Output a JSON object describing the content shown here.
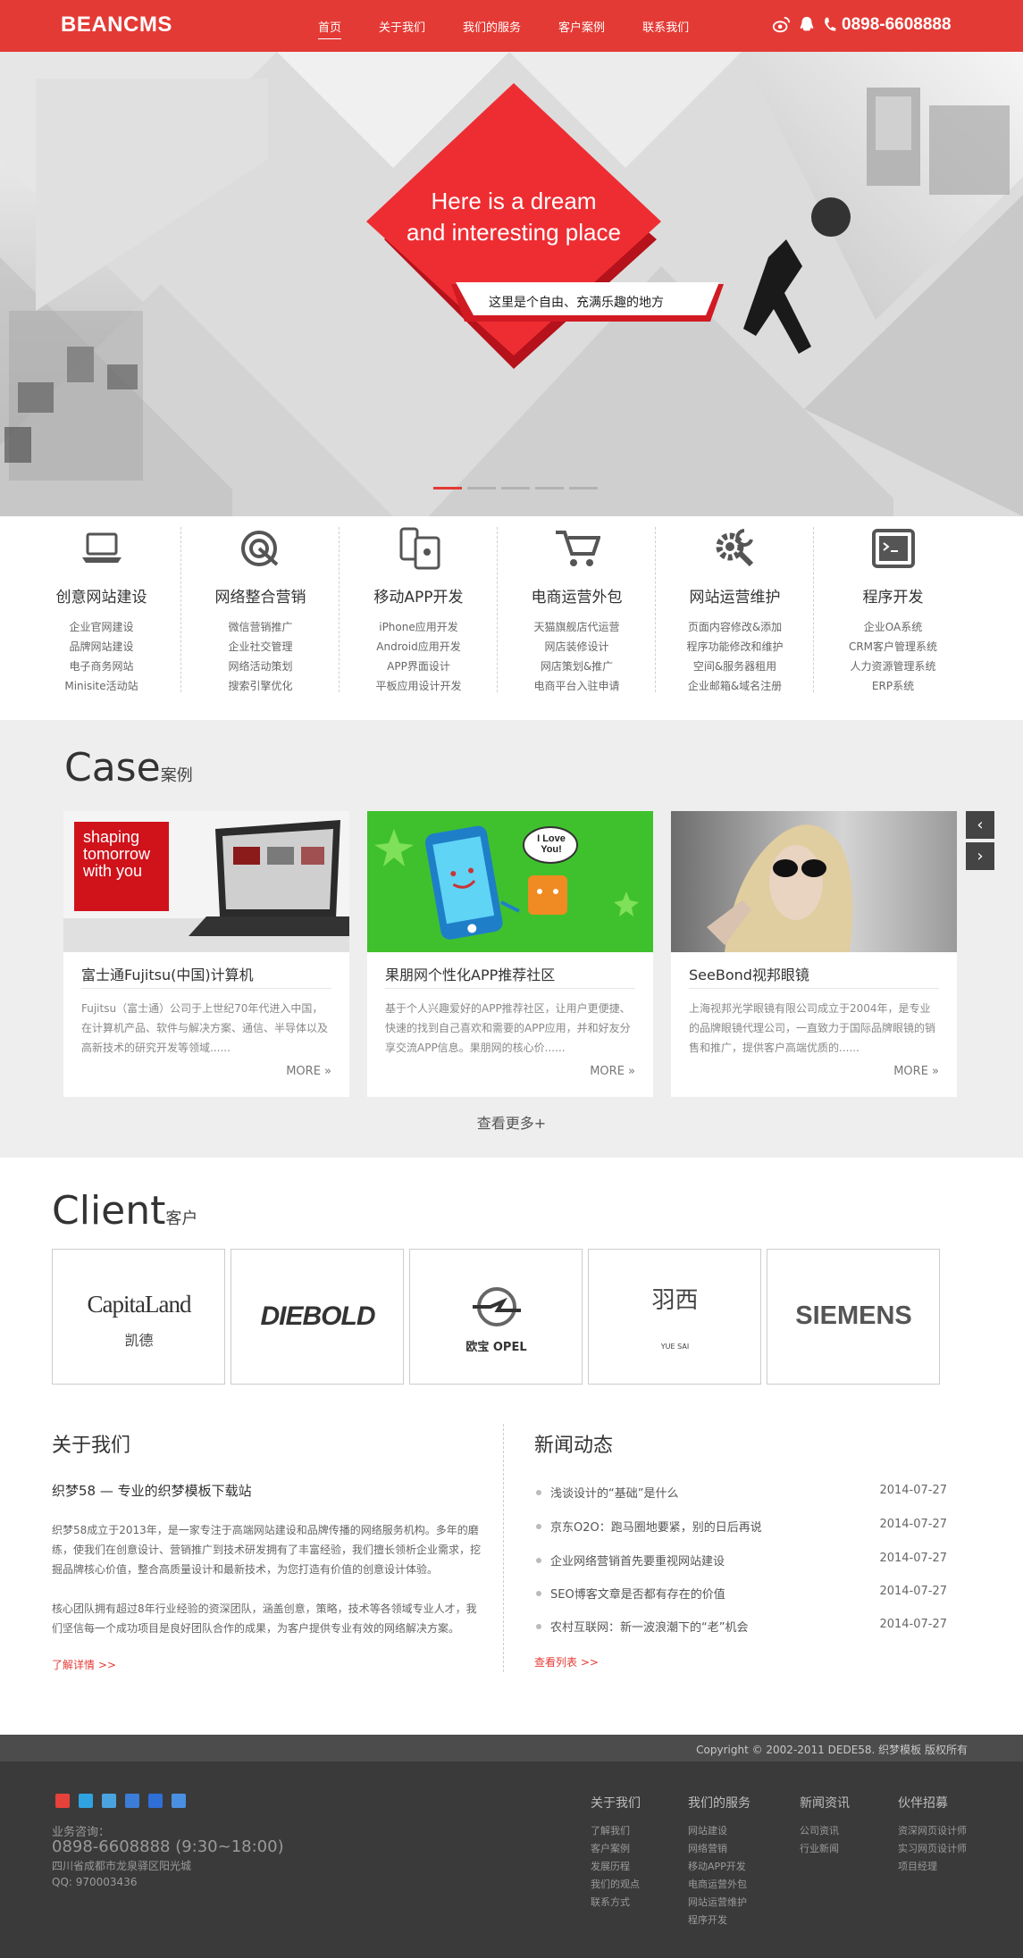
{
  "header": {
    "logo": "BEANCMS",
    "nav": [
      {
        "label": "首页"
      },
      {
        "label": "关于我们"
      },
      {
        "label": "我们的服务"
      },
      {
        "label": "客户案例"
      },
      {
        "label": "联系我们"
      }
    ],
    "phone": "0898-6608888"
  },
  "banner": {
    "headline_line1": "Here is a dream",
    "headline_line2": "and interesting place",
    "sub": "这里是个自由、充满乐趣的地方",
    "slides": 5,
    "active_slide": 1
  },
  "services": [
    {
      "title": "创意网站建设",
      "icon": "laptop-icon",
      "items": [
        "企业官网建设",
        "品牌网站建设",
        "电子商务网站",
        "Minisite活动站"
      ]
    },
    {
      "title": "网络整合营销",
      "icon": "target-icon",
      "items": [
        "微信营销推广",
        "企业社交管理",
        "网络活动策划",
        "搜索引擎优化"
      ]
    },
    {
      "title": "移动APP开发",
      "icon": "mobile-devices-icon",
      "items": [
        "iPhone应用开发",
        "Android应用开发",
        "APP界面设计",
        "平板应用设计开发"
      ]
    },
    {
      "title": "电商运营外包",
      "icon": "cart-icon",
      "items": [
        "天猫旗舰店代运营",
        "网店装修设计",
        "网店策划&推广",
        "电商平台入驻申请"
      ]
    },
    {
      "title": "网站运营维护",
      "icon": "gear-wrench-icon",
      "items": [
        "页面内容修改&添加",
        "程序功能修改和维护",
        "空间&服务器租用",
        "企业邮箱&域名注册"
      ]
    },
    {
      "title": "程序开发",
      "icon": "terminal-icon",
      "items": [
        "企业OA系统",
        "CRM客户管理系统",
        "人力资源管理系统",
        "ERP系统"
      ]
    }
  ],
  "case": {
    "title_en": "Case",
    "title_cn": "案例",
    "prev_label": "‹",
    "next_label": "›",
    "more_label": "MORE »",
    "view_more": "查看更多+",
    "items": [
      {
        "title": "富士通Fujitsu(中国)计算机",
        "image_text": "shaping tomorrow with you",
        "desc": "Fujitsu（富士通）公司于上世纪70年代进入中国，在计算机产品、软件与解决方案、通信、半导体以及高新技术的研究开发等领域......"
      },
      {
        "title": "果朋网个性化APP推荐社区",
        "image_text": "I Love You!",
        "desc": "基于个人兴趣爱好的APP推荐社区，让用户更便捷、快速的找到自己喜欢和需要的APP应用，并和好友分享交流APP信息。果朋网的核心价......"
      },
      {
        "title": "SeeBond视邦眼镜",
        "image_text": "",
        "desc": "上海视邦光学眼镜有限公司成立于2004年，是专业的品牌眼镜代理公司，一直致力于国际品牌眼镜的销售和推广，提供客户高端优质的......"
      }
    ]
  },
  "client": {
    "title_en": "Client",
    "title_cn": "客户",
    "logos": [
      "CapitaLand",
      "凯德",
      "DIEBOLD",
      "欧宝 OPEL",
      "羽西",
      "YUE SAI",
      "SIEMENS"
    ]
  },
  "about": {
    "title": "关于我们",
    "subtitle": "织梦58 — 专业的织梦模板下载站",
    "p1": "织梦58成立于2013年，是一家专注于高端网站建设和品牌传播的网络服务机构。多年的磨练，使我们在创意设计、营销推广到技术研发拥有了丰富经验，我们擅长领析企业需求，挖掘品牌核心价值，整合高质量设计和最新技术，为您打造有价值的创意设计体验。",
    "p2": "核心团队拥有超过8年行业经验的资深团队，涵盖创意，策略，技术等各领域专业人才，我们坚信每一个成功项目是良好团队合作的成果，为客户提供专业有效的网络解决方案。",
    "link": "了解详情 >>"
  },
  "news": {
    "title": "新闻动态",
    "items": [
      {
        "title": "浅谈设计的“基础”是什么",
        "date": "2014-07-27"
      },
      {
        "title": "京东O2O：跑马圈地要紧，别的日后再说",
        "date": "2014-07-27"
      },
      {
        "title": "企业网络营销首先要重视网站建设",
        "date": "2014-07-27"
      },
      {
        "title": "SEO博客文章是否都有存在的价值",
        "date": "2014-07-27"
      },
      {
        "title": "农村互联网：新一波浪潮下的“老”机会",
        "date": "2014-07-27"
      }
    ],
    "link": "查看列表 >>"
  },
  "footer": {
    "copyright": "Copyright © 2002-2011 DEDE58. 织梦模板 版权所有",
    "consult_label": "业务咨询：",
    "phone": "0898-6608888 (9:30~18:00)",
    "address": "四川省成都市龙泉驿区阳光城",
    "qq": "QQ: 970003436",
    "columns": [
      {
        "title": "关于我们",
        "items": [
          "了解我们",
          "客户案例",
          "发展历程",
          "我们的观点",
          "联系方式"
        ]
      },
      {
        "title": "我们的服务",
        "items": [
          "网站建设",
          "网络营销",
          "移动APP开发",
          "电商运营外包",
          "网站运营维护",
          "程序开发"
        ]
      },
      {
        "title": "新闻资讯",
        "items": [
          "公司资讯",
          "行业新闻"
        ]
      },
      {
        "title": "伙伴招募",
        "items": [
          "资深网页设计师",
          "实习网页设计师",
          "项目经理"
        ]
      }
    ]
  },
  "colors": {
    "brand_red": "#e43a35",
    "footer_bg": "#3a3a3a"
  }
}
